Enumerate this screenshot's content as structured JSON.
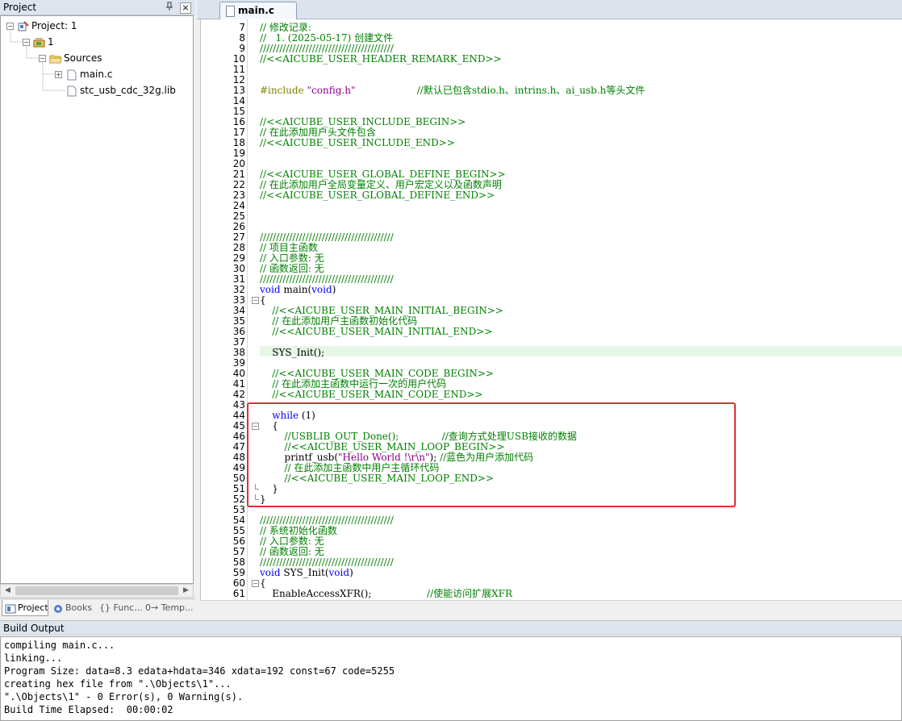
{
  "project_panel": {
    "title": "Project",
    "pin": "ф",
    "close": "×",
    "tree": {
      "project": "Project: 1",
      "target": "1",
      "group": "Sources",
      "files": [
        "main.c",
        "stc_usb_cdc_32g.lib"
      ]
    },
    "tabs": [
      "Project",
      "Books",
      "{} Func...",
      "0→ Temp..."
    ]
  },
  "editor": {
    "tab_label": "main.c",
    "lines": [
      {
        "n": "7",
        "parts": [
          {
            "c": "cm",
            "t": "// 修改记录:"
          }
        ]
      },
      {
        "n": "8",
        "parts": [
          {
            "c": "cm",
            "t": "//   1. (2025-05-17) 创建文件"
          }
        ]
      },
      {
        "n": "9",
        "parts": [
          {
            "c": "cm",
            "t": "/////////////////////////////////////////"
          }
        ]
      },
      {
        "n": "10",
        "parts": [
          {
            "c": "cm",
            "t": "//<<AICUBE_USER_HEADER_REMARK_END>>"
          }
        ]
      },
      {
        "n": "11",
        "parts": []
      },
      {
        "n": "12",
        "parts": []
      },
      {
        "n": "13",
        "parts": [
          {
            "c": "pp",
            "t": "#include "
          },
          {
            "c": "str",
            "t": "\"config.h\""
          },
          {
            "c": "tx",
            "t": "                    "
          },
          {
            "c": "cm",
            "t": "//默认已包含stdio.h、intrins.h、ai_usb.h等头文件"
          }
        ]
      },
      {
        "n": "14",
        "parts": []
      },
      {
        "n": "15",
        "parts": []
      },
      {
        "n": "16",
        "parts": [
          {
            "c": "cm",
            "t": "//<<AICUBE_USER_INCLUDE_BEGIN>>"
          }
        ]
      },
      {
        "n": "17",
        "parts": [
          {
            "c": "cm",
            "t": "// 在此添加用户头文件包含"
          }
        ]
      },
      {
        "n": "18",
        "parts": [
          {
            "c": "cm",
            "t": "//<<AICUBE_USER_INCLUDE_END>>"
          }
        ]
      },
      {
        "n": "19",
        "parts": []
      },
      {
        "n": "20",
        "parts": []
      },
      {
        "n": "21",
        "parts": [
          {
            "c": "cm",
            "t": "//<<AICUBE_USER_GLOBAL_DEFINE_BEGIN>>"
          }
        ]
      },
      {
        "n": "22",
        "parts": [
          {
            "c": "cm",
            "t": "// 在此添加用户全局变量定义、用户宏定义以及函数声明"
          }
        ]
      },
      {
        "n": "23",
        "parts": [
          {
            "c": "cm",
            "t": "//<<AICUBE_USER_GLOBAL_DEFINE_END>>"
          }
        ]
      },
      {
        "n": "24",
        "parts": []
      },
      {
        "n": "25",
        "parts": []
      },
      {
        "n": "26",
        "parts": []
      },
      {
        "n": "27",
        "parts": [
          {
            "c": "cm",
            "t": "/////////////////////////////////////////"
          }
        ]
      },
      {
        "n": "28",
        "parts": [
          {
            "c": "cm",
            "t": "// 项目主函数"
          }
        ]
      },
      {
        "n": "29",
        "parts": [
          {
            "c": "cm",
            "t": "// 入口参数: 无"
          }
        ]
      },
      {
        "n": "30",
        "parts": [
          {
            "c": "cm",
            "t": "// 函数返回: 无"
          }
        ]
      },
      {
        "n": "31",
        "parts": [
          {
            "c": "cm",
            "t": "/////////////////////////////////////////"
          }
        ]
      },
      {
        "n": "32",
        "parts": [
          {
            "c": "kw",
            "t": "void"
          },
          {
            "c": "tx",
            "t": " main("
          },
          {
            "c": "kw",
            "t": "void"
          },
          {
            "c": "tx",
            "t": ")"
          }
        ]
      },
      {
        "n": "33",
        "parts": [
          {
            "c": "tx",
            "t": "{"
          }
        ]
      },
      {
        "n": "34",
        "parts": [
          {
            "c": "cm",
            "t": "    //<<AICUBE_USER_MAIN_INITIAL_BEGIN>>"
          }
        ]
      },
      {
        "n": "35",
        "parts": [
          {
            "c": "cm",
            "t": "    // 在此添加用户主函数初始化代码"
          }
        ]
      },
      {
        "n": "36",
        "parts": [
          {
            "c": "cm",
            "t": "    //<<AICUBE_USER_MAIN_INITIAL_END>>"
          }
        ]
      },
      {
        "n": "37",
        "parts": []
      },
      {
        "n": "38",
        "parts": [
          {
            "c": "tx",
            "t": "    SYS_Init();"
          }
        ]
      },
      {
        "n": "39",
        "parts": []
      },
      {
        "n": "40",
        "parts": [
          {
            "c": "cm",
            "t": "    //<<AICUBE_USER_MAIN_CODE_BEGIN>>"
          }
        ]
      },
      {
        "n": "41",
        "parts": [
          {
            "c": "cm",
            "t": "    // 在此添加主函数中运行一次的用户代码"
          }
        ]
      },
      {
        "n": "42",
        "parts": [
          {
            "c": "cm",
            "t": "    //<<AICUBE_USER_MAIN_CODE_END>>"
          }
        ]
      },
      {
        "n": "43",
        "parts": []
      },
      {
        "n": "44",
        "parts": [
          {
            "c": "tx",
            "t": "    "
          },
          {
            "c": "kw",
            "t": "while"
          },
          {
            "c": "tx",
            "t": " (1)"
          }
        ]
      },
      {
        "n": "45",
        "parts": [
          {
            "c": "tx",
            "t": "    {"
          }
        ]
      },
      {
        "n": "46",
        "parts": [
          {
            "c": "cm",
            "t": "        //USBLIB_OUT_Done();              //查询方式处理USB接收的数据"
          }
        ]
      },
      {
        "n": "47",
        "parts": [
          {
            "c": "cm",
            "t": "        //<<AICUBE_USER_MAIN_LOOP_BEGIN>>"
          }
        ]
      },
      {
        "n": "48",
        "parts": [
          {
            "c": "tx",
            "t": "        printf_usb("
          },
          {
            "c": "str",
            "t": "\"Hello World !\\r\\n\""
          },
          {
            "c": "tx",
            "t": "); "
          },
          {
            "c": "cm",
            "t": "//蓝色为用户添加代码"
          }
        ]
      },
      {
        "n": "49",
        "parts": [
          {
            "c": "cm",
            "t": "        // 在此添加主函数中用户主循环代码"
          }
        ]
      },
      {
        "n": "50",
        "parts": [
          {
            "c": "cm",
            "t": "        //<<AICUBE_USER_MAIN_LOOP_END>>"
          }
        ]
      },
      {
        "n": "51",
        "parts": [
          {
            "c": "tx",
            "t": "    }"
          }
        ]
      },
      {
        "n": "52",
        "parts": [
          {
            "c": "tx",
            "t": "}"
          }
        ]
      },
      {
        "n": "53",
        "parts": []
      },
      {
        "n": "54",
        "parts": [
          {
            "c": "cm",
            "t": "/////////////////////////////////////////"
          }
        ]
      },
      {
        "n": "55",
        "parts": [
          {
            "c": "cm",
            "t": "// 系统初始化函数"
          }
        ]
      },
      {
        "n": "56",
        "parts": [
          {
            "c": "cm",
            "t": "// 入口参数: 无"
          }
        ]
      },
      {
        "n": "57",
        "parts": [
          {
            "c": "cm",
            "t": "// 函数返回: 无"
          }
        ]
      },
      {
        "n": "58",
        "parts": [
          {
            "c": "cm",
            "t": "/////////////////////////////////////////"
          }
        ]
      },
      {
        "n": "59",
        "parts": [
          {
            "c": "kw",
            "t": "void"
          },
          {
            "c": "tx",
            "t": " SYS_Init("
          },
          {
            "c": "kw",
            "t": "void"
          },
          {
            "c": "tx",
            "t": ")"
          }
        ]
      },
      {
        "n": "60",
        "parts": [
          {
            "c": "tx",
            "t": "{"
          }
        ]
      },
      {
        "n": "61",
        "parts": [
          {
            "c": "tx",
            "t": "    EnableAccessXFR();                  "
          },
          {
            "c": "cm",
            "t": "//使能访问扩展XFR"
          }
        ]
      }
    ],
    "current_line": "38",
    "highlighted_block": [
      "44",
      "52"
    ]
  },
  "build_output": {
    "title": "Build Output",
    "lines": [
      "compiling main.c...",
      "linking...",
      "Program Size: data=8.3 edata+hdata=346 xdata=192 const=67 code=5255",
      "creating hex file from \".\\Objects\\1\"...",
      "\".\\Objects\\1\" - 0 Error(s), 0 Warning(s).",
      "Build Time Elapsed:  00:00:02"
    ]
  },
  "colors": {
    "comment": "#008000",
    "keyword": "#0000ff",
    "string": "#8b008b",
    "preprocessor": "#808000",
    "current_line": "#e6f7e6",
    "annotation_box": "#e03030"
  }
}
